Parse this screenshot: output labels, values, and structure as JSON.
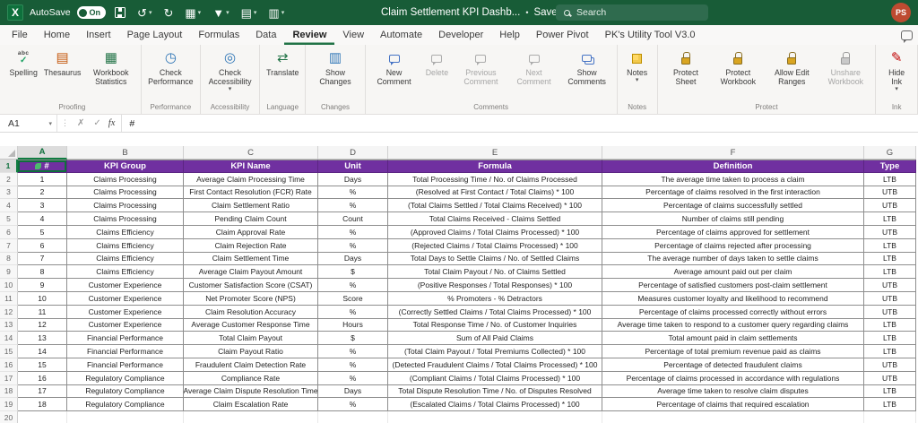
{
  "colors": {
    "titlebar_green": "#185C37",
    "accent_green": "#217346",
    "header_purple": "#7030A0",
    "avatar_red": "#BE4B31"
  },
  "titlebar": {
    "autosave_label": "AutoSave",
    "autosave_state": "On",
    "doc_title": "Claim Settlement KPI Dashb...",
    "saved_label": "Saved",
    "search_placeholder": "Search",
    "avatar_initials": "PS"
  },
  "menubar": {
    "tabs": [
      "File",
      "Home",
      "Insert",
      "Page Layout",
      "Formulas",
      "Data",
      "Review",
      "View",
      "Automate",
      "Developer",
      "Help",
      "Power Pivot",
      "PK's Utility Tool V3.0"
    ],
    "active_tab": "Review"
  },
  "ribbon": {
    "groups": [
      {
        "label": "Proofing",
        "buttons": [
          {
            "label": "Spelling",
            "icon": "spellcheck"
          },
          {
            "label": "Thesaurus",
            "icon": "book"
          },
          {
            "label": "Workbook Statistics",
            "icon": "stats-grid"
          }
        ]
      },
      {
        "label": "Performance",
        "buttons": [
          {
            "label": "Check Performance",
            "icon": "gauge"
          }
        ]
      },
      {
        "label": "Accessibility",
        "buttons": [
          {
            "label": "Check Accessibility",
            "icon": "accessibility",
            "dropdown": true
          }
        ]
      },
      {
        "label": "Language",
        "buttons": [
          {
            "label": "Translate",
            "icon": "translate"
          }
        ]
      },
      {
        "label": "Changes",
        "buttons": [
          {
            "label": "Show Changes",
            "icon": "changes"
          }
        ]
      },
      {
        "label": "Comments",
        "buttons": [
          {
            "label": "New Comment",
            "icon": "comment-new"
          },
          {
            "label": "Delete",
            "icon": "comment-delete",
            "disabled": true
          },
          {
            "label": "Previous Comment",
            "icon": "comment-prev",
            "disabled": true
          },
          {
            "label": "Next Comment",
            "icon": "comment-next",
            "disabled": true
          },
          {
            "label": "Show Comments",
            "icon": "comments-show"
          }
        ]
      },
      {
        "label": "Notes",
        "buttons": [
          {
            "label": "Notes",
            "icon": "note",
            "dropdown": true
          }
        ]
      },
      {
        "label": "Protect",
        "buttons": [
          {
            "label": "Protect Sheet",
            "icon": "lock-sheet"
          },
          {
            "label": "Protect Workbook",
            "icon": "lock-book"
          },
          {
            "label": "Allow Edit Ranges",
            "icon": "edit-ranges"
          },
          {
            "label": "Unshare Workbook",
            "icon": "unshare",
            "disabled": true
          }
        ]
      },
      {
        "label": "Ink",
        "buttons": [
          {
            "label": "Hide Ink",
            "icon": "ink",
            "dropdown": true
          }
        ]
      }
    ]
  },
  "formula_bar": {
    "name_box": "A1",
    "fx_label": "fx",
    "cell_content": "#"
  },
  "sheet": {
    "column_letters": [
      "A",
      "B",
      "C",
      "D",
      "E",
      "F",
      "G"
    ],
    "selected_cell": "A1",
    "header_row": [
      "#",
      "KPI Group",
      "KPI Name",
      "Unit",
      "Formula",
      "Definition",
      "Type"
    ],
    "rows": [
      [
        "1",
        "Claims Processing",
        "Average Claim Processing Time",
        "Days",
        "Total Processing Time / No. of Claims Processed",
        "The average time taken to process a claim",
        "LTB"
      ],
      [
        "2",
        "Claims Processing",
        "First Contact Resolution (FCR) Rate",
        "%",
        "(Resolved at First Contact / Total Claims) * 100",
        "Percentage of claims resolved in the first interaction",
        "UTB"
      ],
      [
        "3",
        "Claims Processing",
        "Claim Settlement Ratio",
        "%",
        "(Total Claims Settled / Total Claims Received) * 100",
        "Percentage of claims successfully settled",
        "UTB"
      ],
      [
        "4",
        "Claims Processing",
        "Pending Claim Count",
        "Count",
        "Total Claims Received - Claims Settled",
        "Number of claims still pending",
        "LTB"
      ],
      [
        "5",
        "Claims Efficiency",
        "Claim Approval Rate",
        "%",
        "(Approved Claims / Total Claims Processed) * 100",
        "Percentage of claims approved for settlement",
        "UTB"
      ],
      [
        "6",
        "Claims Efficiency",
        "Claim Rejection Rate",
        "%",
        "(Rejected Claims / Total Claims Processed) * 100",
        "Percentage of claims rejected after processing",
        "LTB"
      ],
      [
        "7",
        "Claims Efficiency",
        "Claim Settlement Time",
        "Days",
        "Total Days to Settle Claims / No. of Settled Claims",
        "The average number of days taken to settle claims",
        "LTB"
      ],
      [
        "8",
        "Claims Efficiency",
        "Average Claim Payout Amount",
        "$",
        "Total Claim Payout / No. of Claims Settled",
        "Average amount paid out per claim",
        "LTB"
      ],
      [
        "9",
        "Customer Experience",
        "Customer Satisfaction Score (CSAT)",
        "%",
        "(Positive Responses / Total Responses) * 100",
        "Percentage of satisfied customers post-claim settlement",
        "UTB"
      ],
      [
        "10",
        "Customer Experience",
        "Net Promoter Score (NPS)",
        "Score",
        "% Promoters - % Detractors",
        "Measures customer loyalty and likelihood to recommend",
        "UTB"
      ],
      [
        "11",
        "Customer Experience",
        "Claim Resolution Accuracy",
        "%",
        "(Correctly Settled Claims / Total Claims Processed) * 100",
        "Percentage of claims processed correctly without errors",
        "UTB"
      ],
      [
        "12",
        "Customer Experience",
        "Average Customer Response Time",
        "Hours",
        "Total Response Time / No. of Customer Inquiries",
        "Average time taken to respond to a customer query regarding claims",
        "LTB"
      ],
      [
        "13",
        "Financial Performance",
        "Total Claim Payout",
        "$",
        "Sum of All Paid Claims",
        "Total amount paid in claim settlements",
        "LTB"
      ],
      [
        "14",
        "Financial Performance",
        "Claim Payout Ratio",
        "%",
        "(Total Claim Payout / Total Premiums Collected) * 100",
        "Percentage of total premium revenue paid as claims",
        "LTB"
      ],
      [
        "15",
        "Financial Performance",
        "Fraudulent Claim Detection Rate",
        "%",
        "(Detected Fraudulent Claims / Total Claims Processed) * 100",
        "Percentage of detected fraudulent claims",
        "UTB"
      ],
      [
        "16",
        "Regulatory Compliance",
        "Compliance Rate",
        "%",
        "(Compliant Claims / Total Claims Processed) * 100",
        "Percentage of claims processed in accordance with regulations",
        "UTB"
      ],
      [
        "17",
        "Regulatory Compliance",
        "Average Claim Dispute Resolution Time",
        "Days",
        "Total Dispute Resolution Time / No. of Disputes Resolved",
        "Average time taken to resolve claim disputes",
        "LTB"
      ],
      [
        "18",
        "Regulatory Compliance",
        "Claim Escalation Rate",
        "%",
        "(Escalated Claims / Total Claims Processed) * 100",
        "Percentage of claims that required escalation",
        "LTB"
      ]
    ]
  }
}
